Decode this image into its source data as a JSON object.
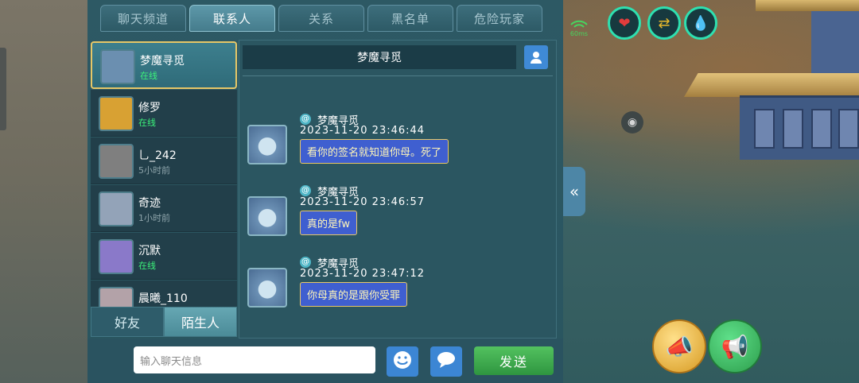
{
  "tabs": [
    "聊天频道",
    "联系人",
    "关系",
    "黑名单",
    "危险玩家"
  ],
  "active_tab": 1,
  "contacts": [
    {
      "name": "梦魔寻觅",
      "status": "在线",
      "online": true,
      "selected": true,
      "avatar_color": "#6b8fb0"
    },
    {
      "name": "修罗",
      "status": "在线",
      "online": true,
      "selected": false,
      "avatar_color": "#d8a133"
    },
    {
      "name": "乚_242",
      "status": "5小时前",
      "online": false,
      "selected": false,
      "avatar_color": "#7f7f7f"
    },
    {
      "name": "奇迹",
      "status": "1小时前",
      "online": false,
      "selected": false,
      "avatar_color": "#93a3b8"
    },
    {
      "name": "沉默",
      "status": "在线",
      "online": true,
      "selected": false,
      "avatar_color": "#8a79c9"
    },
    {
      "name": "晨曦_110",
      "status": "",
      "online": false,
      "selected": false,
      "avatar_color": "#b3a2a8"
    }
  ],
  "bottom_tabs": [
    "好友",
    "陌生人"
  ],
  "active_bottom_tab": 1,
  "chat": {
    "header": "梦魔寻觅",
    "messages": [
      {
        "name": "梦魔寻觅",
        "time": "2023-11-20  23:46:44",
        "text": "看你的签名就知道你母。死了"
      },
      {
        "name": "梦魔寻觅",
        "time": "2023-11-20  23:46:57",
        "text": "真的是fw"
      },
      {
        "name": "梦魔寻觅",
        "time": "2023-11-20  23:47:12",
        "text": "你母真的是跟你受罪"
      }
    ]
  },
  "input": {
    "placeholder": "输入聊天信息"
  },
  "send_label": "发送",
  "hud": {
    "signal": "60ms"
  },
  "colors": {
    "online": "#3cf27a",
    "send": "#3aa94a",
    "accent": "#3c86d4",
    "bubble": "#3f5fd0"
  }
}
